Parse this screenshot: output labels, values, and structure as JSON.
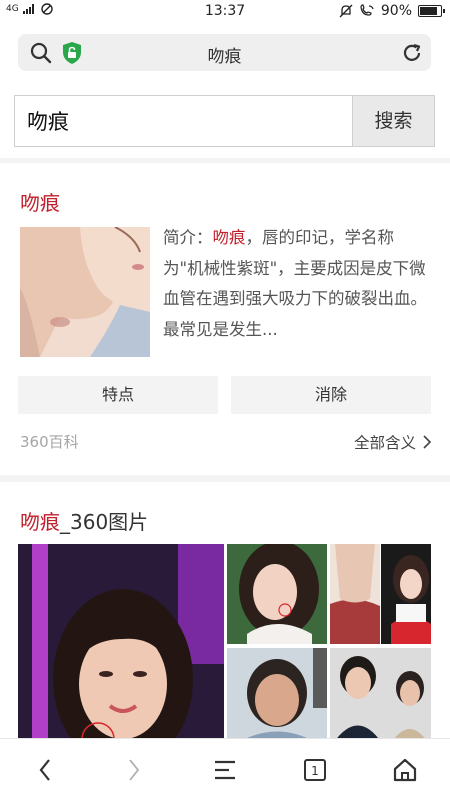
{
  "status_bar": {
    "network": "4G",
    "time": "13:37",
    "battery": "90%",
    "battery_level": 0.9
  },
  "address_bar": {
    "title": "吻痕"
  },
  "search": {
    "query": "吻痕",
    "button_label": "搜索"
  },
  "encyclopedia_card": {
    "title": "吻痕",
    "summary_prefix": "简介：",
    "summary_keyword": "吻痕",
    "summary_rest": "，唇的印记，学名称为\"机械性紫斑\"，主要成因是皮下微血管在遇到强大吸力下的破裂出血。最常见是发生...",
    "chips": [
      "特点",
      "消除"
    ],
    "source": "360百科",
    "more_label": "全部含义"
  },
  "image_card": {
    "title_keyword": "吻痕",
    "title_suffix": "_360图片"
  },
  "icons": {
    "address_left": [
      "search-icon",
      "shield-icon"
    ],
    "address_right": "reload-icon",
    "bottom_nav": [
      "back-icon",
      "forward-icon",
      "menu-icon",
      "tabs-icon",
      "home-icon"
    ]
  },
  "tabs_count": "1",
  "colors": {
    "accent_red": "#c0212d",
    "shield_green": "#2aa74a",
    "muted_text": "#a6a6a6"
  }
}
